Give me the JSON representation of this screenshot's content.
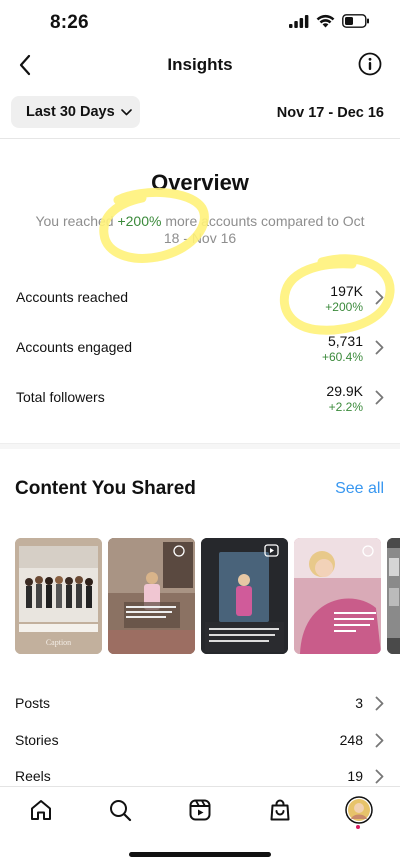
{
  "status_bar": {
    "time": "8:26"
  },
  "header": {
    "title": "Insights"
  },
  "filter": {
    "range_label": "Last 30 Days",
    "date_range": "Nov 17 - Dec 16"
  },
  "overview": {
    "title": "Overview",
    "subtitle_before": "You reached ",
    "subtitle_pct": "+200%",
    "subtitle_after": " more accounts compared to Oct 18 - Nov 16"
  },
  "metrics": [
    {
      "label": "Accounts reached",
      "value": "197K",
      "change": "+200%"
    },
    {
      "label": "Accounts engaged",
      "value": "5,731",
      "change": "+60.4%"
    },
    {
      "label": "Total followers",
      "value": "29.9K",
      "change": "+2.2%"
    }
  ],
  "content_shared": {
    "title": "Content You Shared",
    "see_all": "See all",
    "thumbnails": [
      {
        "type": "post",
        "caption": "Caption"
      },
      {
        "type": "reel"
      },
      {
        "type": "reel"
      },
      {
        "type": "reel"
      },
      {
        "type": "post"
      }
    ]
  },
  "counts": [
    {
      "label": "Posts",
      "value": "3"
    },
    {
      "label": "Stories",
      "value": "248"
    },
    {
      "label": "Reels",
      "value": "19"
    }
  ],
  "tab_bar": {
    "items": [
      "home-icon",
      "search-icon",
      "reels-icon",
      "shop-icon",
      "profile-avatar"
    ]
  },
  "colors": {
    "positive": "#3b8a3b",
    "link": "#3897f0",
    "highlight": "#fff27a"
  }
}
